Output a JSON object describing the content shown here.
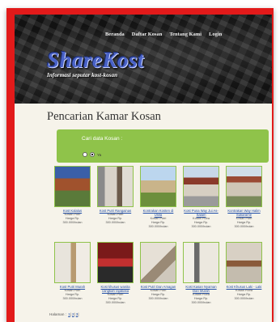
{
  "nav": [
    "Beranda",
    "Daftar Kosan",
    "Tentang Kami",
    "Login"
  ],
  "brand": {
    "title": "ShareKost",
    "subtitle": "Informasi seputar kost-kosan",
    "accent": "#4a63c8"
  },
  "page_title": "Pencarian Kamar Kosan",
  "search": {
    "label": "Cari data Kosan :",
    "radio_label": "Ya",
    "box_color": "#8fc34a"
  },
  "listings": [
    {
      "title": "Kost Kalalus",
      "line1": "Kosan Putri",
      "line2": "Harga Rp.",
      "line3": "300.000/bulan"
    },
    {
      "title": "Kost Putri Rangainas",
      "line1": "Kosan Putri",
      "line2": "Harga Rp.",
      "line3": "300.000/bulan"
    },
    {
      "title": "Kontrakan Kosten di Unila",
      "line1": "Kosan Putri",
      "line2": "Harga Rp.",
      "line3": "300.000/bulan"
    },
    {
      "title": "Kost Puna Way Jui As-Salam",
      "line1": "Kosan Putra",
      "line2": "Harga Rp.",
      "line3": "300.000/bulan"
    },
    {
      "title": "Kontrakan Way Halim Sukarame",
      "line1": "Kosan Putri",
      "line2": "Harga Rp.",
      "line3": "300.000/bulan"
    },
    {
      "title": "Kost Putri Murah",
      "line1": "Kosan Putri",
      "line2": "Harga Rp.",
      "line3": "300.000/bulan"
    },
    {
      "title": "Kost khusus wanita cangkah rajabasa",
      "line1": "Kosan Putri",
      "line2": "Harga Rp.",
      "line3": "300.000/bulan"
    },
    {
      "title": "Kost Putri Dan Amagan",
      "line1": "Kosan Putri",
      "line2": "Harga Rp.",
      "line3": "300.000/bulan"
    },
    {
      "title": "Kost Kasan Nyaman Dan Murah",
      "line1": "Kosan Putra",
      "line2": "Harga Rp.",
      "line3": "300.000/bulan"
    },
    {
      "title": "Kost Khusus Laki - Laki",
      "line1": "Kosan Putra",
      "line2": "Harga Rp.",
      "line3": "300.000/bulan"
    }
  ],
  "pagination": {
    "label": "Halaman :",
    "pages": [
      "1",
      "2",
      "3"
    ]
  }
}
